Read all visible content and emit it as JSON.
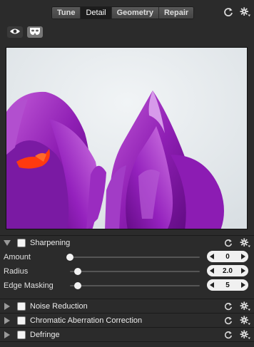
{
  "tabs": [
    {
      "label": "Tune",
      "active": false
    },
    {
      "label": "Detail",
      "active": true
    },
    {
      "label": "Geometry",
      "active": false
    },
    {
      "label": "Repair",
      "active": false
    }
  ],
  "icons": {
    "reset": "reset-icon",
    "gear": "gear-icon",
    "eye": "eye-icon",
    "mask": "mask-icon"
  },
  "preview": {
    "subject": "purple-crocus-flowers"
  },
  "sharpening": {
    "title": "Sharpening",
    "expanded": true,
    "enabled": false,
    "sliders": [
      {
        "label": "Amount",
        "value": "0",
        "level": 0.0
      },
      {
        "label": "Radius",
        "value": "2.0",
        "level": 0.06
      },
      {
        "label": "Edge Masking",
        "value": "5",
        "level": 0.06
      }
    ]
  },
  "panels": [
    {
      "title": "Noise Reduction",
      "expanded": false,
      "enabled": false
    },
    {
      "title": "Chromatic Aberration Correction",
      "expanded": false,
      "enabled": false
    },
    {
      "title": "Defringe",
      "expanded": false,
      "enabled": false
    }
  ],
  "colors": {
    "background": "#2b2b2b",
    "flower": "#9b1fbf",
    "stamen": "#ff3a10"
  }
}
